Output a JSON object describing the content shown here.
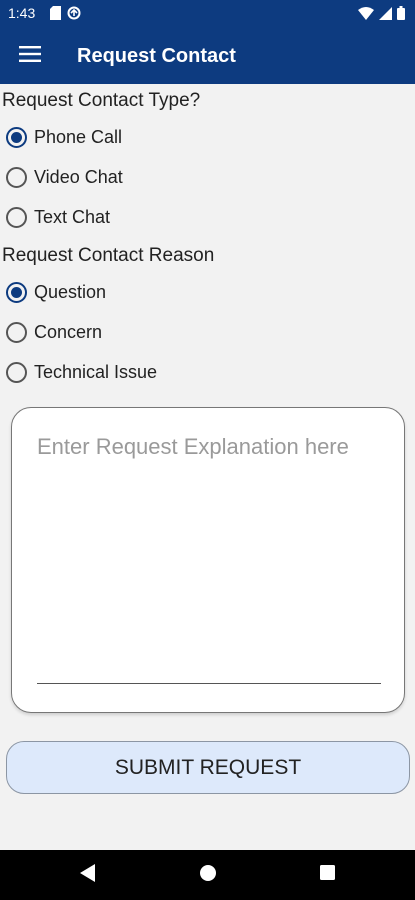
{
  "status_bar": {
    "time": "1:43",
    "icons_left": [
      "sd-card-icon",
      "sync-icon"
    ],
    "icons_right": [
      "wifi-icon",
      "signal-icon",
      "battery-icon"
    ]
  },
  "app_bar": {
    "title": "Request Contact",
    "menu_icon": "hamburger-menu-icon"
  },
  "contact_type": {
    "label": "Request Contact Type?",
    "options": [
      {
        "label": "Phone Call",
        "checked": true
      },
      {
        "label": "Video Chat",
        "checked": false
      },
      {
        "label": "Text Chat",
        "checked": false
      }
    ]
  },
  "contact_reason": {
    "label": "Request Contact Reason",
    "options": [
      {
        "label": "Question",
        "checked": true
      },
      {
        "label": "Concern",
        "checked": false
      },
      {
        "label": "Technical Issue",
        "checked": false
      }
    ]
  },
  "explanation": {
    "value": "",
    "placeholder": "Enter Request Explanation here"
  },
  "submit": {
    "label": "SUBMIT REQUEST"
  },
  "nav_bar": {
    "icons": [
      "back-icon",
      "home-icon",
      "recents-icon"
    ]
  },
  "colors": {
    "primary": "#0d3b80",
    "background": "#f2f2f2",
    "button_fill": "#dde9fb"
  }
}
